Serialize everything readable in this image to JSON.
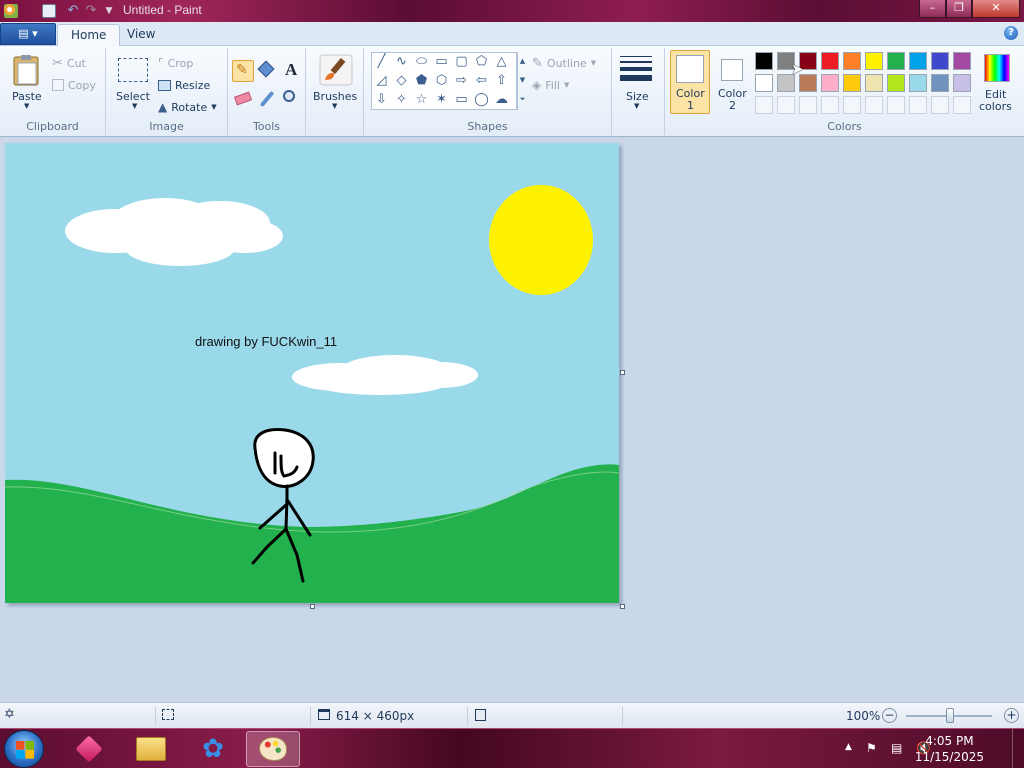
{
  "window": {
    "title": "Untitled - Paint",
    "min_label": "–",
    "max_label": "❐",
    "close_label": "✕"
  },
  "tabs": {
    "file_menu": "▤ ▾",
    "home": "Home",
    "view": "View",
    "help": "?"
  },
  "ribbon": {
    "clipboard": {
      "label": "Clipboard",
      "paste": "Paste",
      "cut": "Cut",
      "copy": "Copy"
    },
    "image": {
      "label": "Image",
      "select": "Select",
      "crop": "Crop",
      "resize": "Resize",
      "rotate": "Rotate"
    },
    "tools": {
      "label": "Tools"
    },
    "brushes": {
      "label": "Brushes"
    },
    "shapes": {
      "label": "Shapes",
      "outline": "Outline",
      "fill": "Fill"
    },
    "size": {
      "label": "Size"
    },
    "colors": {
      "label": "Colors",
      "color1": "Color",
      "color1_num": "1",
      "color2": "Color",
      "color2_num": "2",
      "edit1": "Edit",
      "edit2": "colors",
      "color1_value": "#ffffff",
      "color2_value": "#ffffff",
      "palette_row1": [
        "#000000",
        "#7f7f7f",
        "#880015",
        "#ed1c24",
        "#ff7f27",
        "#fff200",
        "#22b14c",
        "#00a2e8",
        "#3f48cc",
        "#a349a4"
      ],
      "palette_row2": [
        "#ffffff",
        "#c3c3c3",
        "#b97a57",
        "#ffaec9",
        "#ffc90e",
        "#efe4b0",
        "#b5e61d",
        "#99d9ea",
        "#7092be",
        "#c8bfe7"
      ]
    }
  },
  "canvas": {
    "caption": "drawing by FUCKwin_11",
    "sky_color": "#99d9ea",
    "grass_color": "#22b14c",
    "sun_color": "#fff200"
  },
  "status": {
    "dimensions": "614 × 460px",
    "zoom": "100%"
  },
  "taskbar": {
    "time": "4:05 PM",
    "date": "11/15/2025"
  }
}
